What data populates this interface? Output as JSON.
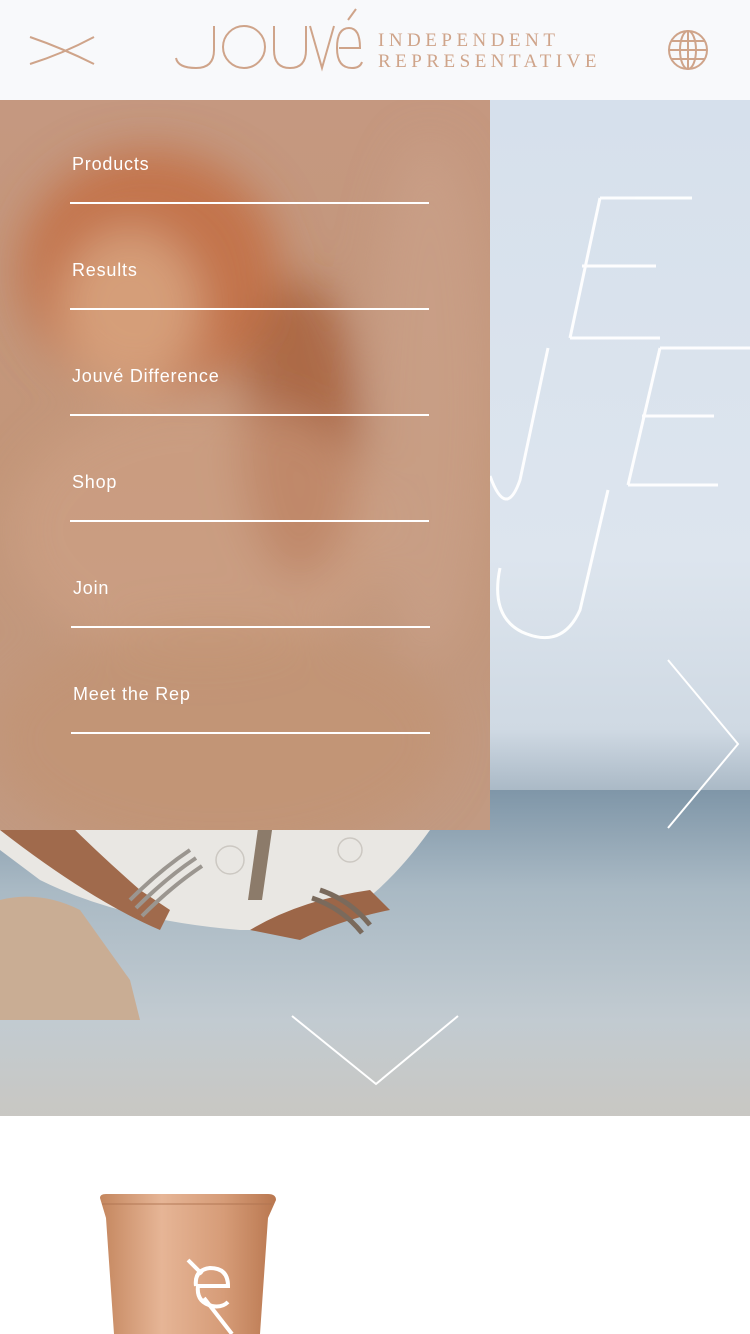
{
  "header": {
    "logo_text": "JOUVÉ",
    "tagline_line1": "INDEPENDENT",
    "tagline_line2": "REPRESENTATIVE",
    "close_icon": "close-x-icon",
    "globe_icon": "globe-icon"
  },
  "menu": {
    "items": [
      {
        "label": "Products"
      },
      {
        "label": "Results"
      },
      {
        "label": "Jouvé Difference"
      },
      {
        "label": "Shop"
      },
      {
        "label": "Join"
      },
      {
        "label": "Meet the Rep"
      }
    ]
  },
  "hero": {
    "next_icon": "chevron-right-icon",
    "scroll_icon": "chevron-down-icon"
  },
  "colors": {
    "brand": "#cfa48a",
    "menu_bg": "#c39679",
    "header_bg": "#f8f9fb",
    "menu_text": "#ffffff"
  }
}
